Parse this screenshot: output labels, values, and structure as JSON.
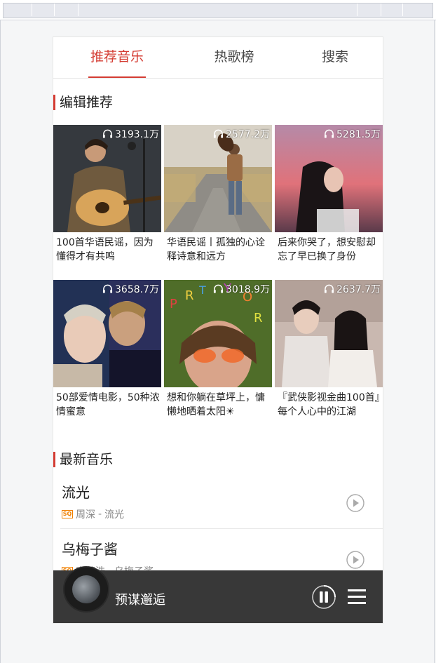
{
  "tabs": [
    {
      "label": "推荐音乐",
      "active": true
    },
    {
      "label": "热歌榜",
      "active": false
    },
    {
      "label": "搜索",
      "active": false
    }
  ],
  "sections": {
    "recommend_title": "编辑推荐",
    "new_title": "最新音乐"
  },
  "playlists": [
    {
      "count": "3193.1万",
      "title": "100首华语民谣，因为懂得才有共鸣"
    },
    {
      "count": "2577.2万",
      "title": "华语民谣丨孤独的心诠释诗意和远方"
    },
    {
      "count": "5281.5万",
      "title": "后来你哭了，想安慰却忘了早已换了身份"
    },
    {
      "count": "3658.7万",
      "title": "50部爱情电影，50种浓情蜜意"
    },
    {
      "count": "3018.9万",
      "title": "想和你躺在草坪上，慵懒地晒着太阳☀"
    },
    {
      "count": "2637.7万",
      "title": "『武侠影视金曲100首』每个人心中的江湖"
    }
  ],
  "songs": [
    {
      "name": "流光",
      "badge": "SQ",
      "artist": "周深",
      "separator": "-",
      "album": "流光"
    },
    {
      "name": "乌梅子酱",
      "badge": "SQ",
      "artist": "李荣浩",
      "separator": "-",
      "album": "乌梅子酱"
    }
  ],
  "player": {
    "title": "预谋邂逅"
  },
  "colors": {
    "accent": "#d43c33",
    "player_bg": "#383838"
  }
}
